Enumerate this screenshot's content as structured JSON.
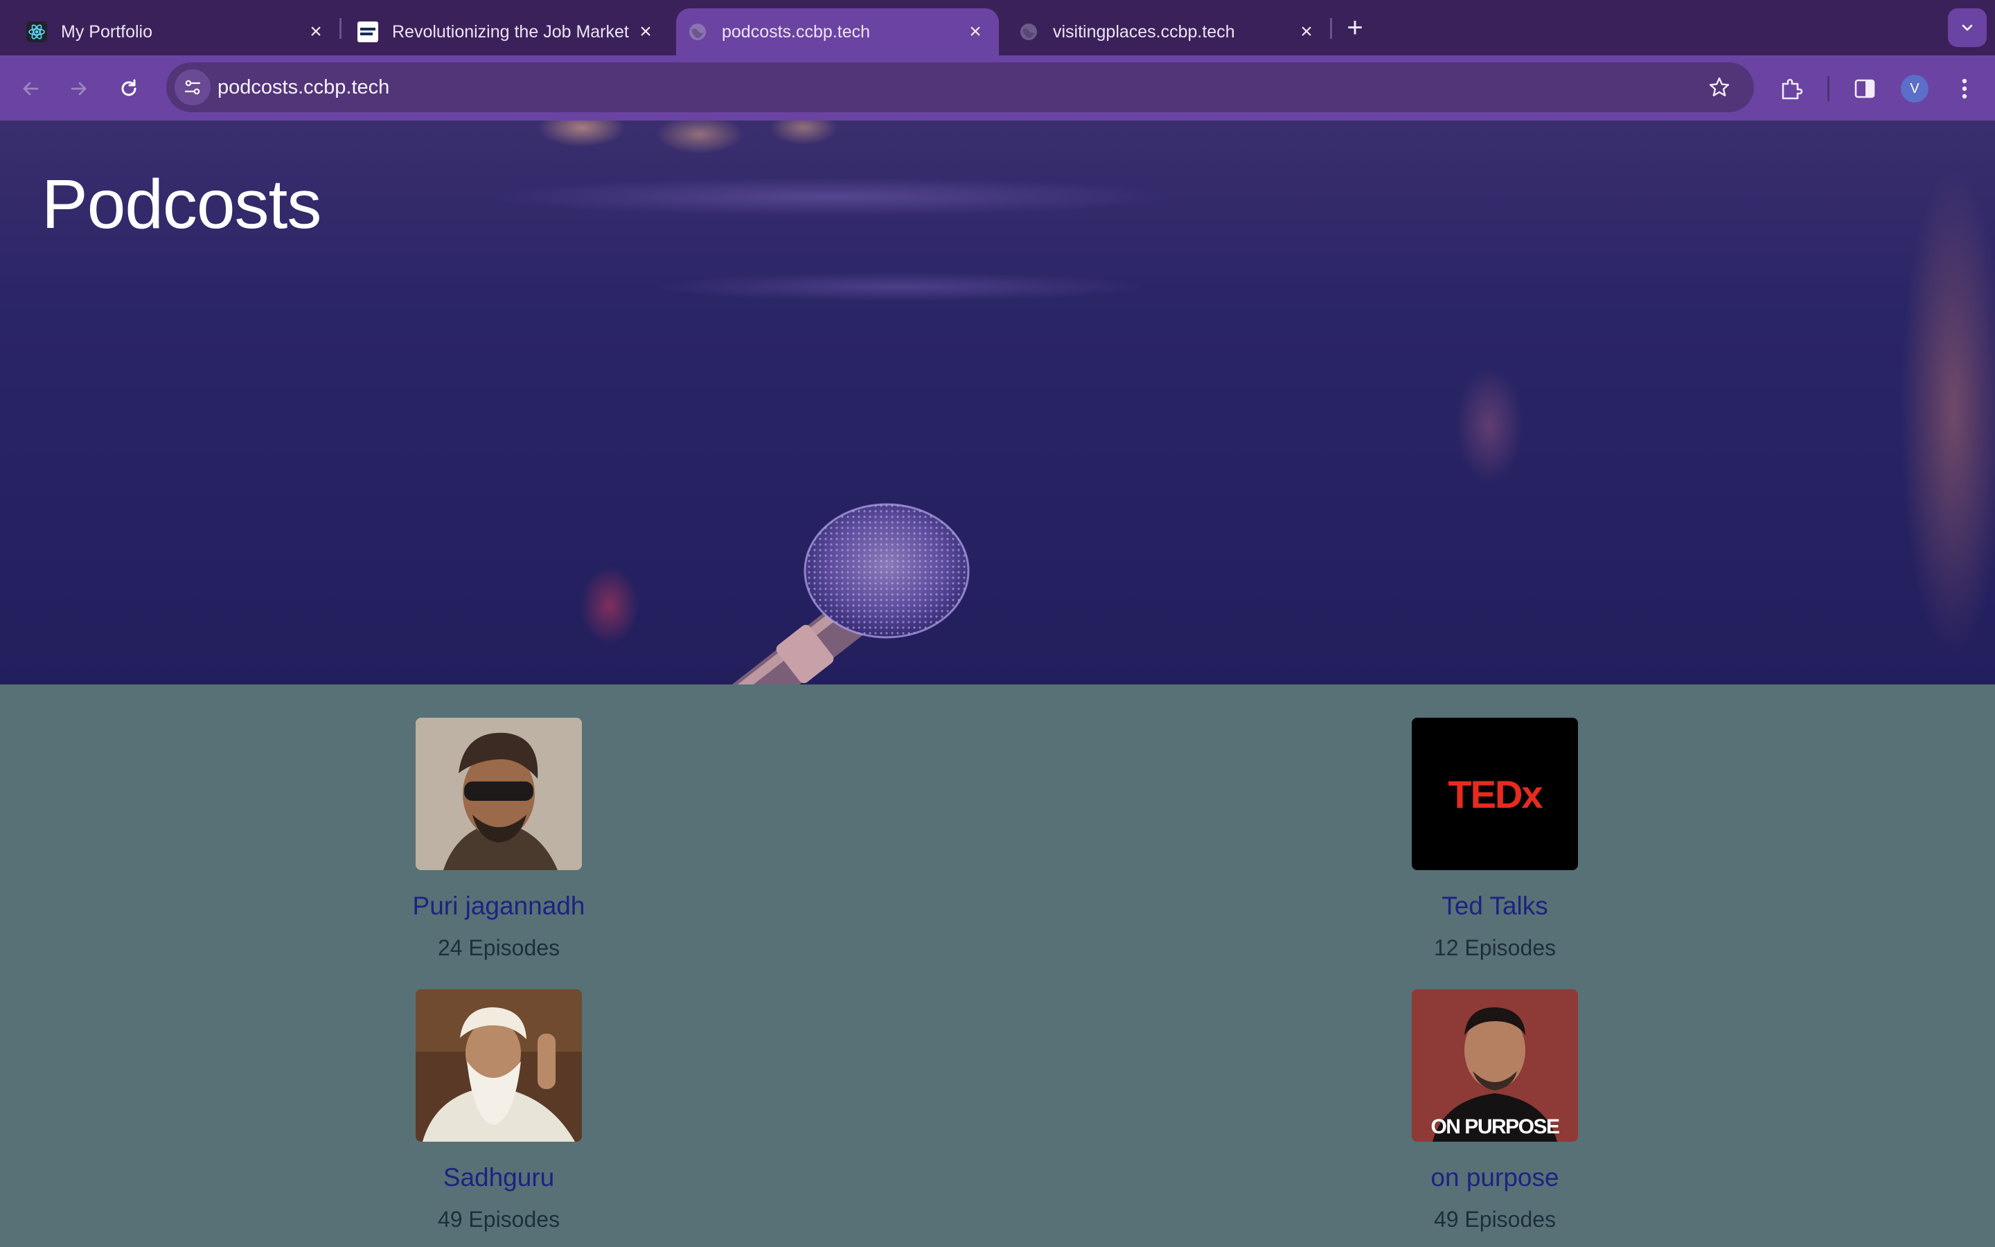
{
  "browser": {
    "tabs": [
      {
        "title": "My Portfolio",
        "icon": "react-icon",
        "active": false
      },
      {
        "title": "Revolutionizing the Job Market",
        "icon": "nxtwave-icon",
        "active": false
      },
      {
        "title": "podcosts.ccbp.tech",
        "icon": "globe-icon",
        "active": true
      },
      {
        "title": "visitingplaces.ccbp.tech",
        "icon": "globe-icon",
        "active": false
      }
    ],
    "url": "podcosts.ccbp.tech",
    "profile_initial": "V"
  },
  "hero": {
    "title": "Podcosts"
  },
  "podcasts": [
    {
      "name": "Puri jagannadh",
      "episodes": "24 Episodes"
    },
    {
      "name": "Ted Talks",
      "episodes": "12 Episodes",
      "logo_text": "TEDx"
    },
    {
      "name": "Sadhguru",
      "episodes": "49 Episodes"
    },
    {
      "name": "on purpose",
      "episodes": "49 Episodes",
      "logo_text": "ON PURPOSE"
    }
  ],
  "colors": {
    "tabbar": "#3b2159",
    "toolbar": "#6b43a2",
    "content_bg": "#577176",
    "link": "#1d2380"
  }
}
